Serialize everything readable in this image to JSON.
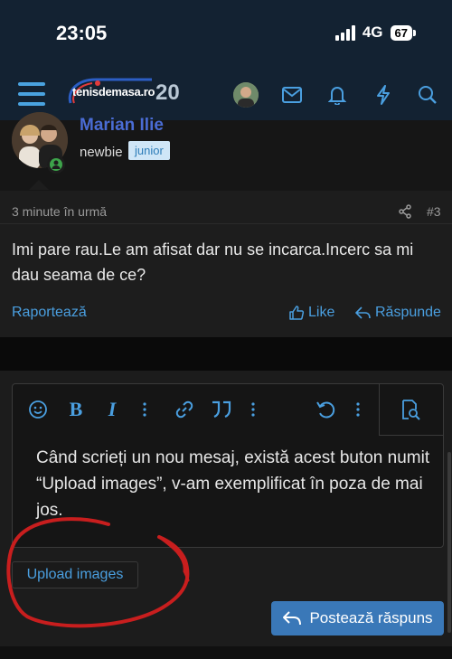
{
  "status_bar": {
    "time": "23:05",
    "network": "4G",
    "battery": "67"
  },
  "header": {
    "logo_text": "tenisdemasa.ro",
    "logo_number": "20",
    "icons": [
      "menu-icon",
      "avatar",
      "mail-icon",
      "bell-icon",
      "bolt-icon",
      "search-icon"
    ]
  },
  "post": {
    "username": "Marian Ilie",
    "rank": "newbie",
    "badge": "junior",
    "time_ago": "3 minute în urmă",
    "post_number": "#3",
    "body": "Imi pare rau.Le am afisat dar nu se incarca.Incerc sa mi dau seama de ce?",
    "actions": {
      "report": "Raportează",
      "like": "Like",
      "reply": "Răspunde"
    }
  },
  "reply": {
    "toolbar_icons": [
      "emoji-icon",
      "bold-icon",
      "italic-icon",
      "more-icon",
      "link-icon",
      "quote-icon",
      "more-icon",
      "undo-icon",
      "more-icon",
      "preview-icon"
    ],
    "bold_glyph": "B",
    "italic_glyph": "I",
    "editor_text": "Când scrieți un nou mesaj, există acest buton numit “Upload images”, v-am exemplificat în poza de mai jos.",
    "upload_label": "Upload images",
    "submit_label": "Postează răspuns"
  },
  "colors": {
    "header_bg": "#132232",
    "accent": "#4a9fe0",
    "username": "#4a6cd4",
    "submit_bg": "#3a78b8",
    "annotation": "#c81e1e"
  }
}
